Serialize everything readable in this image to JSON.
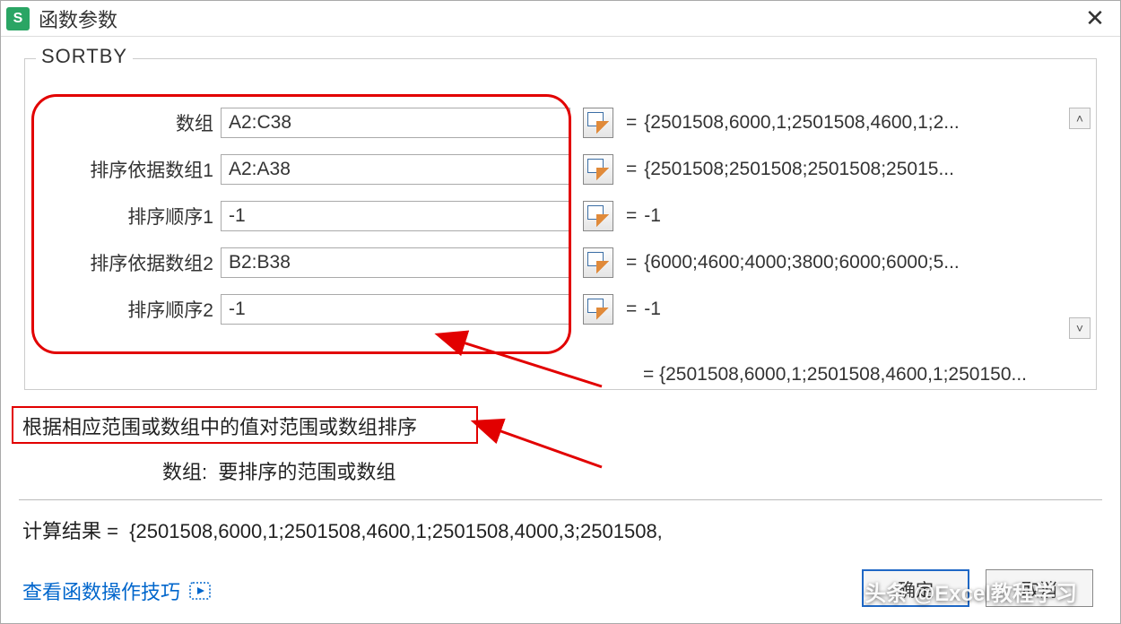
{
  "window": {
    "title": "函数参数",
    "app_icon_letter": "S"
  },
  "function_name": "SORTBY",
  "args": [
    {
      "label": "数组",
      "value": "A2:C38",
      "preview": "{2501508,6000,1;2501508,4600,1;2..."
    },
    {
      "label": "排序依据数组1",
      "value": "A2:A38",
      "preview": "{2501508;2501508;2501508;25015..."
    },
    {
      "label": "排序顺序1",
      "value": "-1",
      "preview": "-1"
    },
    {
      "label": "排序依据数组2",
      "value": "B2:B38",
      "preview": "{6000;4600;4000;3800;6000;6000;5..."
    },
    {
      "label": "排序顺序2",
      "value": "-1",
      "preview": "-1"
    }
  ],
  "final_preview": "=  {2501508,6000,1;2501508,4600,1;250150...",
  "desc": {
    "function": "根据相应范围或数组中的值对范围或数组排序",
    "arg_name": "数组:",
    "arg_desc": "要排序的范围或数组"
  },
  "calc_result_label": "计算结果  =",
  "calc_result_value": "{2501508,6000,1;2501508,4600,1;2501508,4000,3;2501508,",
  "help_link": "查看函数操作技巧",
  "buttons": {
    "ok": "确定",
    "cancel": "取消"
  },
  "watermark": "头条 @Excel教程学习"
}
